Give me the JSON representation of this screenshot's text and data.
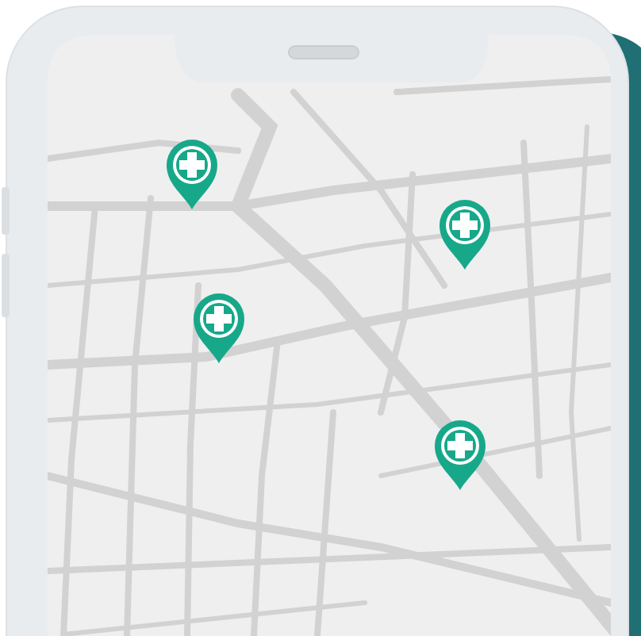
{
  "phone": {
    "map": {
      "pins": [
        {
          "kind": "medical"
        },
        {
          "kind": "medical"
        },
        {
          "kind": "medical"
        },
        {
          "kind": "medical"
        }
      ]
    }
  }
}
